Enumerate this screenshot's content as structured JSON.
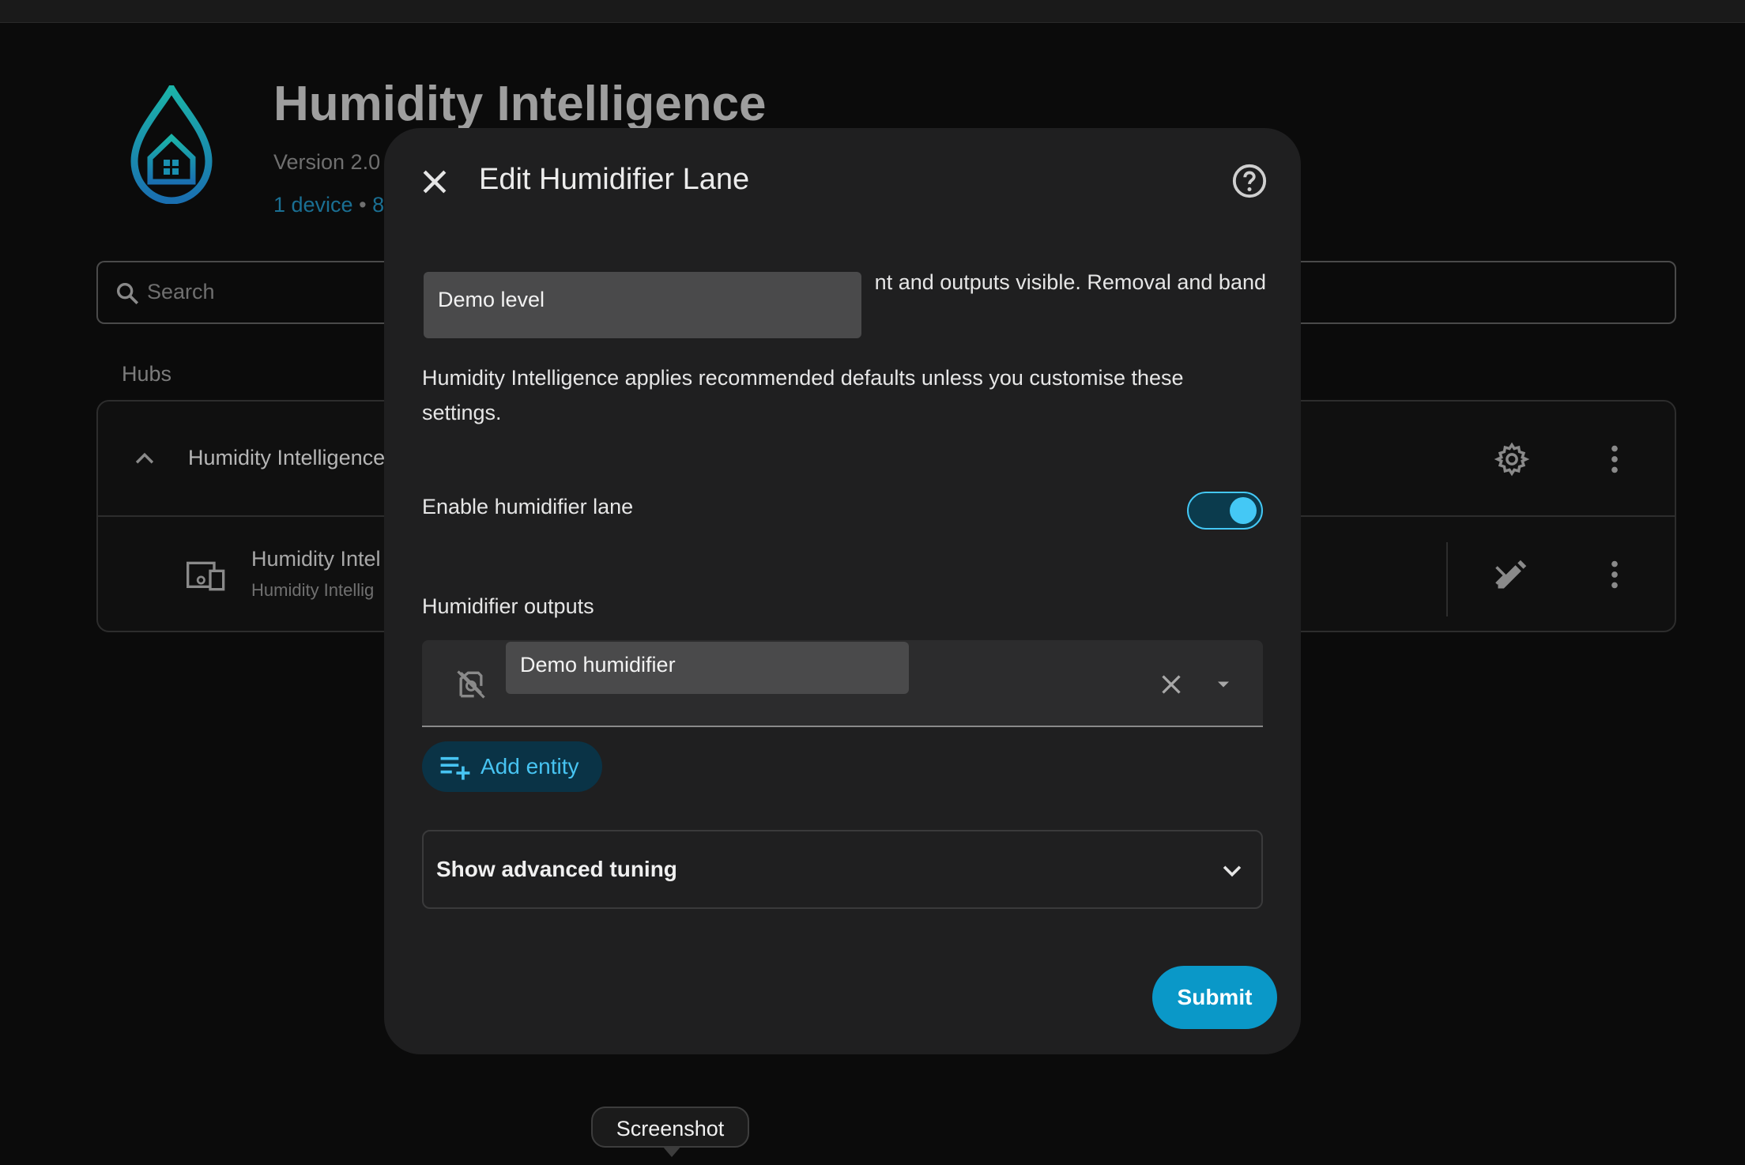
{
  "background": {
    "app_title": "Humidity Intelligence",
    "version_text": "Version 2.0",
    "links": {
      "device": "1 device",
      "separator": "•",
      "more": "8"
    },
    "search_placeholder": "Search",
    "section_label": "Hubs",
    "hub": {
      "name": "Humidity Intelligence"
    },
    "device": {
      "name": "Humidity Intel",
      "subtitle": "Humidity Intellig"
    }
  },
  "dialog": {
    "title": "Edit Humidifier Lane",
    "description_line": "nt and outputs visible. Removal and band",
    "tooltip_level": "Demo level",
    "description_para": "Humidity Intelligence applies recommended defaults unless you customise these settings.",
    "toggle_label": "Enable humidifier lane",
    "toggle_on": true,
    "outputs_label": "Humidifier outputs",
    "tooltip_humidifier": "Demo humidifier",
    "add_entity_label": "Add entity",
    "advanced_label": "Show advanced tuning",
    "submit_label": "Submit"
  },
  "screenshot_tooltip": "Screenshot",
  "colors": {
    "accent": "#44c8f5",
    "submit_bg": "#0a98c8",
    "dialog_bg": "#1f1f20",
    "page_bg": "#0b0b0b"
  }
}
